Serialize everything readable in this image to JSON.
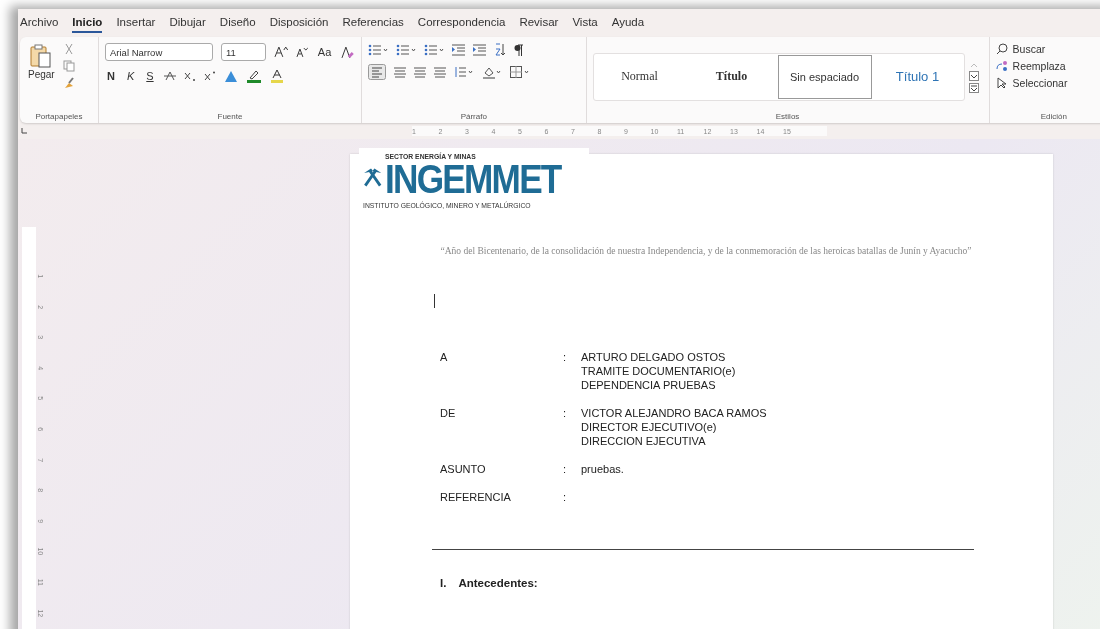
{
  "tabs": [
    {
      "label": "Archivo",
      "selected": false
    },
    {
      "label": "Inicio",
      "selected": true
    },
    {
      "label": "Insertar",
      "selected": false
    },
    {
      "label": "Dibujar",
      "selected": false
    },
    {
      "label": "Diseño",
      "selected": false
    },
    {
      "label": "Disposición",
      "selected": false
    },
    {
      "label": "Referencias",
      "selected": false
    },
    {
      "label": "Correspondencia",
      "selected": false
    },
    {
      "label": "Revisar",
      "selected": false
    },
    {
      "label": "Vista",
      "selected": false
    },
    {
      "label": "Ayuda",
      "selected": false
    }
  ],
  "ribbon": {
    "clipboard": {
      "paste": "Pegar",
      "label": "Portapapeles"
    },
    "font": {
      "name": "Arial Narrow",
      "size": "11",
      "change_case": "Aa",
      "bold": "N",
      "italic": "K",
      "underline": "S",
      "label": "Fuente"
    },
    "paragraph": {
      "label": "Párrafo"
    },
    "styles": {
      "label": "Estilos",
      "items": [
        {
          "label": "Normal",
          "kind": "normal",
          "selected": false
        },
        {
          "label": "Título",
          "kind": "title",
          "selected": false
        },
        {
          "label": "Sin espaciado",
          "kind": "plain",
          "selected": true
        },
        {
          "label": "Título 1",
          "kind": "heading",
          "selected": false
        }
      ]
    },
    "editing": {
      "label": "Edición",
      "items": [
        {
          "label": "Buscar",
          "kind": "search"
        },
        {
          "label": "Reemplaza",
          "kind": "replace"
        },
        {
          "label": "Seleccionar",
          "kind": "select"
        }
      ]
    }
  },
  "ruler": {
    "h_marks": [
      "1",
      "2",
      "3",
      "4",
      "5",
      "6",
      "7",
      "8",
      "9",
      "10",
      "11",
      "12",
      "13",
      "14",
      "15"
    ],
    "v_marks": [
      "1",
      "2",
      "3",
      "4",
      "5",
      "6",
      "7",
      "8",
      "9",
      "10",
      "11",
      "12"
    ]
  },
  "document": {
    "logo": {
      "sector": "SECTOR ENERGÍA Y MINAS",
      "name": "INGEMMET",
      "institute": "INSTITUTO GEOLÓGICO, MINERO Y METALÚRGICO"
    },
    "motto": "“Año del Bicentenario, de la consolidación de nuestra Independencia, y de la conmemoración de las heroicas batallas de Junín y Ayacucho”",
    "fields": [
      {
        "label": "A",
        "separator": ":",
        "lines": [
          "ARTURO DELGADO OSTOS",
          "TRAMITE DOCUMENTARIO(e)",
          "DEPENDENCIA PRUEBAS"
        ]
      },
      {
        "label": "DE",
        "separator": ":",
        "lines": [
          "VICTOR ALEJANDRO BACA RAMOS",
          "DIRECTOR EJECUTIVO(e)",
          "DIRECCION EJECUTIVA"
        ]
      },
      {
        "label": "ASUNTO",
        "separator": ":",
        "lines": [
          "pruebas."
        ]
      },
      {
        "label": "REFERENCIA",
        "separator": ":"
      }
    ],
    "section": {
      "number": "I.",
      "title": "Antecedentes:"
    }
  }
}
